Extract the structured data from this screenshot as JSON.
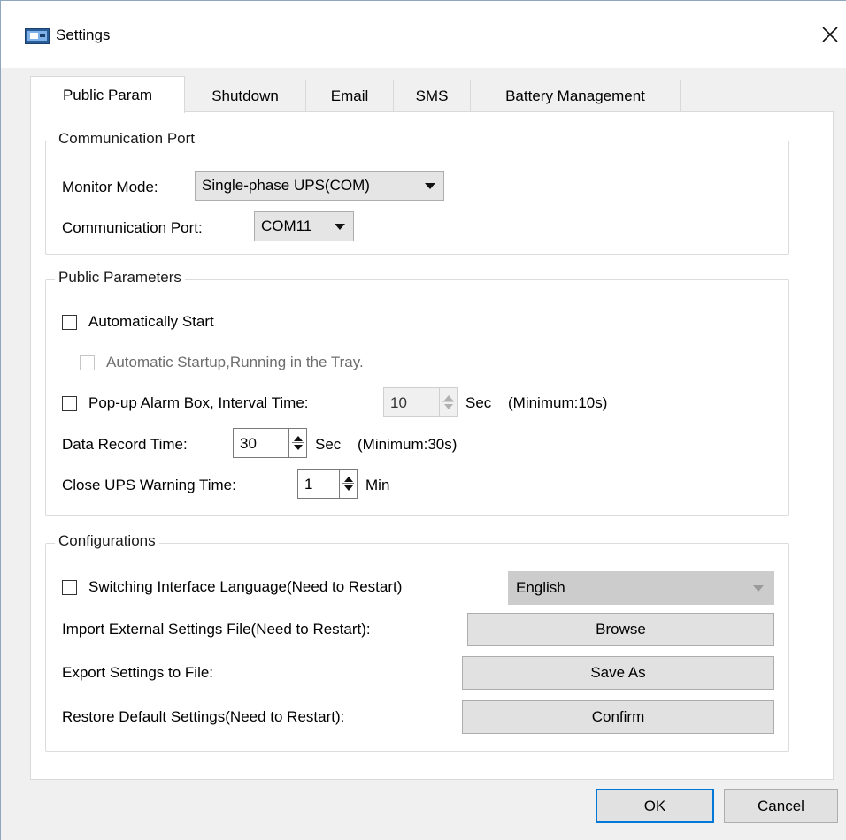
{
  "window": {
    "title": "Settings",
    "app_icon": "settings-app-icon",
    "close_icon": "close-icon"
  },
  "tabs": [
    {
      "label": "Public Param",
      "active": true
    },
    {
      "label": "Shutdown",
      "active": false
    },
    {
      "label": "Email",
      "active": false
    },
    {
      "label": "SMS",
      "active": false
    },
    {
      "label": "Battery Management",
      "active": false
    }
  ],
  "communication_port": {
    "legend": "Communication Port",
    "monitor_mode_label": "Monitor Mode:",
    "monitor_mode_value": "Single-phase UPS(COM)",
    "port_label": "Communication Port:",
    "port_value": "COM11"
  },
  "public_parameters": {
    "legend": "Public Parameters",
    "auto_start_label": "Automatically Start",
    "auto_start_checked": false,
    "tray_label": "Automatic Startup,Running in the Tray.",
    "tray_checked": false,
    "popup_label": "Pop-up Alarm Box, Interval Time:",
    "popup_checked": false,
    "popup_value": "10",
    "popup_unit": "Sec",
    "popup_min": "(Minimum:10s)",
    "record_label": "Data Record Time:",
    "record_value": "30",
    "record_unit": "Sec",
    "record_min": "(Minimum:30s)",
    "close_warning_label": "Close UPS Warning Time:",
    "close_warning_value": "1",
    "close_warning_unit": "Min"
  },
  "configurations": {
    "legend": "Configurations",
    "language_label": "Switching Interface Language(Need to Restart)",
    "language_checked": false,
    "language_value": "English",
    "import_label": "Import External Settings File(Need to Restart):",
    "import_button": "Browse",
    "export_label": "Export Settings to File:",
    "export_button": "Save As",
    "restore_label": "Restore Default Settings(Need to Restart):",
    "restore_button": "Confirm"
  },
  "footer": {
    "ok_label": "OK",
    "cancel_label": "Cancel"
  },
  "colors": {
    "accent": "#0078d7",
    "dialog_bg": "#f0f0f0",
    "panel_bg": "#ffffff"
  }
}
